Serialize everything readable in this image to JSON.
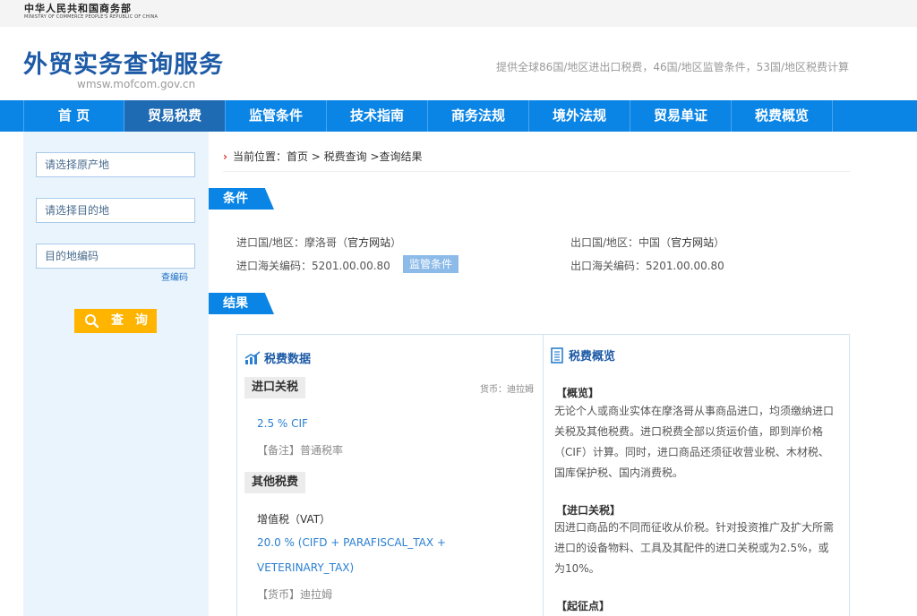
{
  "ministry": {
    "name_cn": "中华人民共和国商务部",
    "name_en": "MINISTRY OF COMMERCE PEOPLE'S REPUBLIC OF CHINA"
  },
  "header": {
    "title": "外贸实务查询服务",
    "url": "wmsw.mofcom.gov.cn",
    "description": "提供全球86国/地区进出口税费，46国/地区监管条件，53国/地区税费计算"
  },
  "nav": {
    "items": [
      "首 页",
      "贸易税费",
      "监管条件",
      "技术指南",
      "商务法规",
      "境外法规",
      "贸易单证",
      "税费概览"
    ],
    "active_index": 1
  },
  "sidebar": {
    "origin_placeholder": "请选择原产地",
    "destination_placeholder": "请选择目的地",
    "hs_code_placeholder": "目的地编码",
    "lookup_link": "查编码",
    "query_button": "查 询"
  },
  "breadcrumb": {
    "label": "当前位置：",
    "home": "首页",
    "sep": " > ",
    "tax_query": "税费查询",
    "current": " >查询结果"
  },
  "conditions": {
    "tag": "条件",
    "import_country_label": "进口国/地区：",
    "import_country": "摩洛哥",
    "import_site": "官方网站",
    "import_code_label": "进口海关编码：",
    "import_code": "5201.00.00.80",
    "monitor_button": "监管条件",
    "export_country_label": "出口国/地区：",
    "export_country": "中国",
    "export_site": "官方网站",
    "export_code_label": "出口海关编码：",
    "export_code": "5201.00.00.80"
  },
  "result": {
    "tag": "结果",
    "tax_data": {
      "title": "税费数据",
      "import_duty_head": "进口关税",
      "currency": "货币：迪拉姆",
      "import_rate": "2.5 % CIF",
      "import_note": "【备注】普通税率",
      "other_head": "其他税费",
      "vat_label": "增值税（VAT）",
      "vat_rate_line1": "20.0 % (CIFD + PARAFISCAL_TAX +",
      "vat_rate_line2": "VETERINARY_TAX)",
      "vat_currency": "【货币】迪拉姆"
    },
    "overview": {
      "title": "税费概览",
      "s1_title": "【概览】",
      "s1_text": "无论个人或商业实体在摩洛哥从事商品进口，均须缴纳进口关税及其他税费。进口税费全部以货运价值，即到岸价格（CIF）计算。同时，进口商品还须征收营业税、木材税、国库保护税、国内消费税。",
      "s2_title": "【进口关税】",
      "s2_text": "因进口商品的不同而征收从价税。针对投资推广及扩大所需进口的设备物料、工具及其配件的进口关税或为2.5%，或为10%。",
      "s3_title": "【起征点】"
    }
  },
  "colors": {
    "brand_blue": "#0a85e6",
    "nav_active": "#1f6bb3",
    "query_orange": "#ffb400",
    "title_blue": "#1d5aa6"
  }
}
